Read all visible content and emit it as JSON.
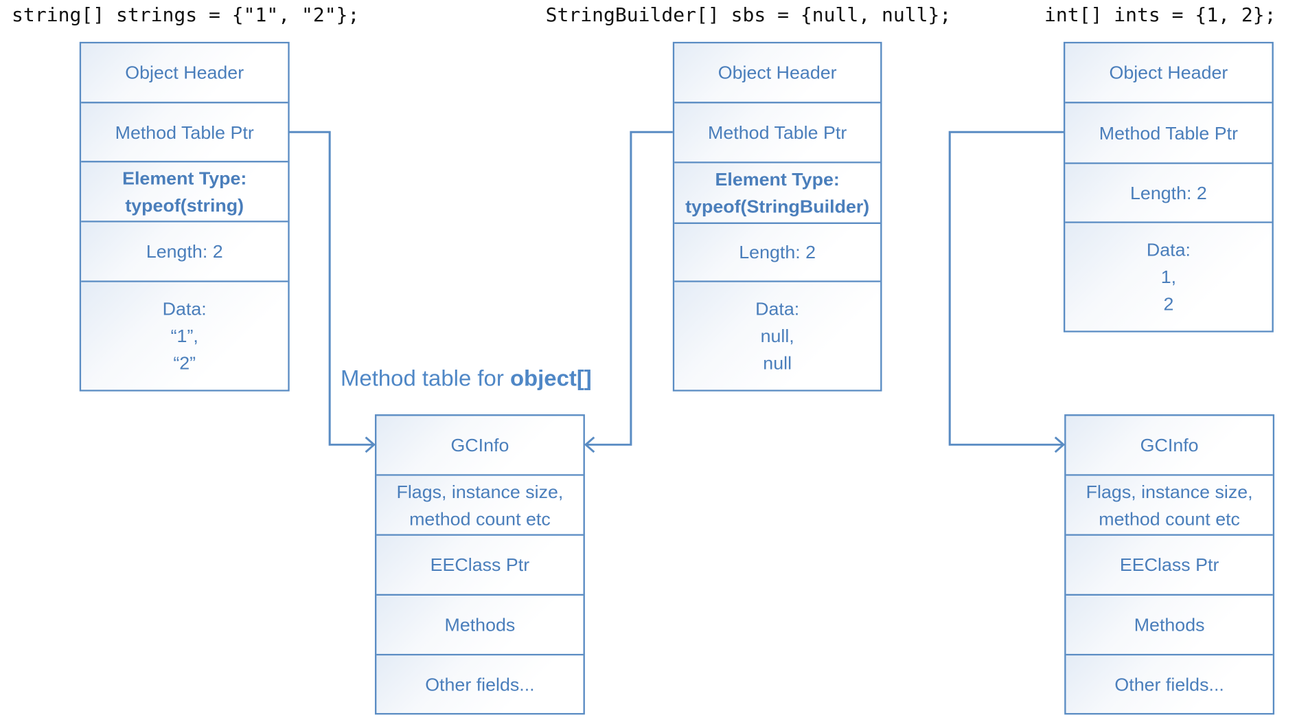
{
  "code_lines": {
    "strings": "string[] strings = {\"1\", \"2\"};",
    "sbs": "StringBuilder[] sbs = {null, null};",
    "ints": "int[] ints = {1, 2};"
  },
  "strings_array": {
    "rows": [
      [
        "Object Header"
      ],
      [
        "Method Table Ptr"
      ],
      [
        "Element Type:",
        "typeof(string)"
      ],
      [
        "Length: 2"
      ],
      [
        "Data:",
        "“1”,",
        "“2”"
      ]
    ]
  },
  "sbs_array": {
    "rows": [
      [
        "Object Header"
      ],
      [
        "Method Table Ptr"
      ],
      [
        "Element Type:",
        "typeof(StringBuilder)"
      ],
      [
        "Length: 2"
      ],
      [
        "Data:",
        "null,",
        "null"
      ]
    ]
  },
  "ints_array": {
    "rows": [
      [
        "Object Header"
      ],
      [
        "Method Table Ptr"
      ],
      [
        "Length: 2"
      ],
      [
        "Data:",
        "1,",
        "2"
      ]
    ]
  },
  "object_method_table": {
    "label_prefix": "Method table for ",
    "label_bold": "object[]",
    "rows": [
      [
        "GCInfo"
      ],
      [
        "Flags, instance size,",
        "method count etc"
      ],
      [
        "EEClass Ptr"
      ],
      [
        "Methods"
      ],
      [
        "Other fields..."
      ]
    ]
  },
  "int_method_table": {
    "rows": [
      [
        "GCInfo"
      ],
      [
        "Flags, instance size,",
        "method count etc"
      ],
      [
        "EEClass Ptr"
      ],
      [
        "Methods"
      ],
      [
        "Other fields..."
      ]
    ]
  },
  "colors": {
    "border": "#5a8cc3",
    "text": "#4a7ebb",
    "arrow": "#5a8cc3"
  }
}
